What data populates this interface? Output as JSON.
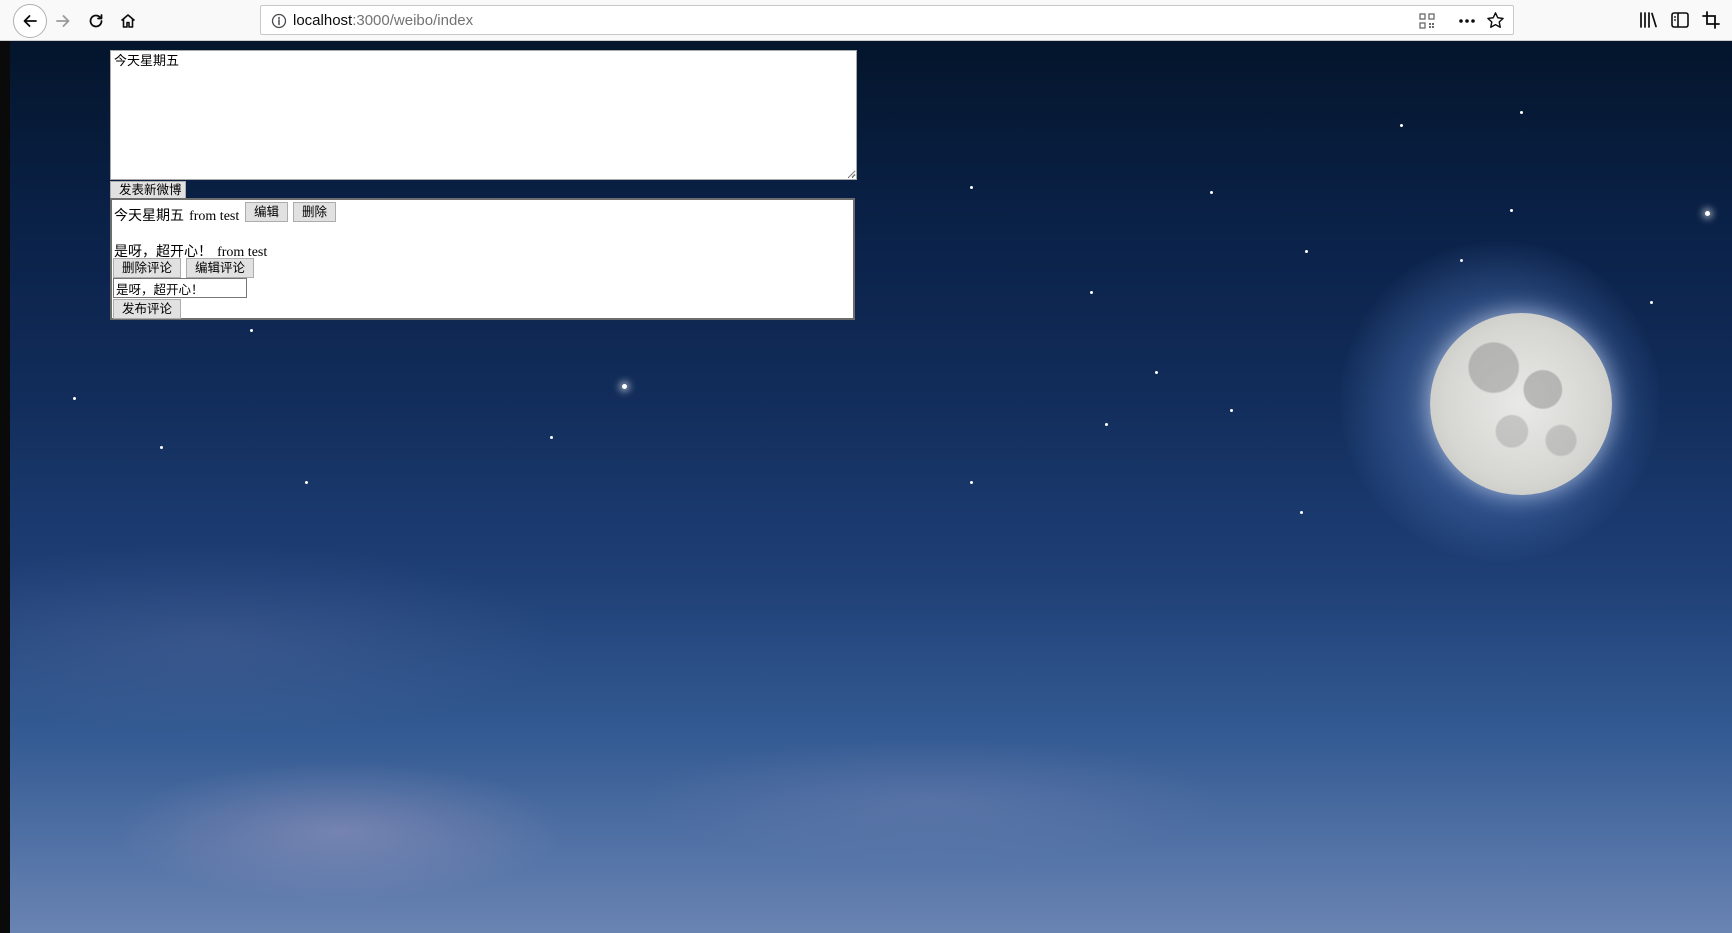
{
  "browser": {
    "url_host": "localhost",
    "url_path": ":3000/weibo/index"
  },
  "compose": {
    "text": "今天星期五",
    "post_button": "发表新微博"
  },
  "weibo": {
    "content": "今天星期五",
    "from": "from test",
    "edit_button": "编辑",
    "delete_button": "删除",
    "comment": {
      "content": "是呀，超开心！",
      "from": "from test",
      "delete_button": "删除评论",
      "edit_button": "编辑评论",
      "input_value": "是呀，超开心！",
      "publish_button": "发布评论"
    }
  },
  "colors": {
    "sky_top": "#04152c",
    "sky_bottom": "#6a84b2",
    "button_bg": "#e1e1e1"
  }
}
